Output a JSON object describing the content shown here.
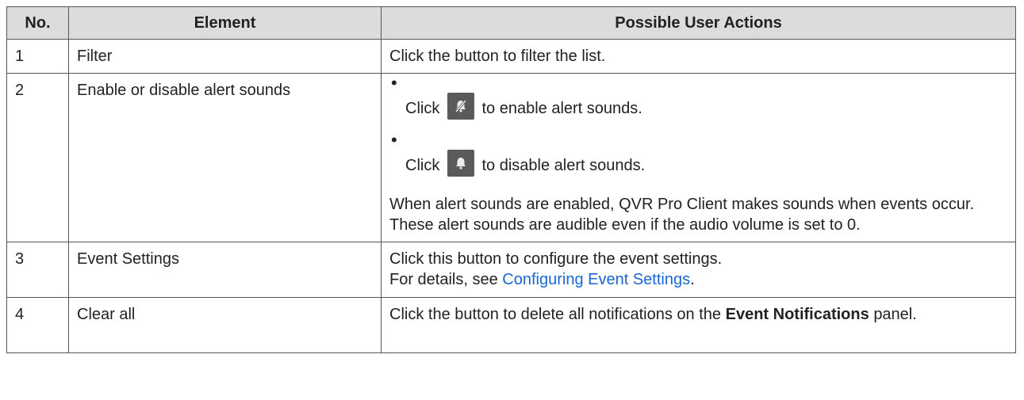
{
  "table": {
    "headers": [
      "No.",
      "Element",
      "Possible User Actions"
    ],
    "rows": [
      {
        "no": "1",
        "element": "Filter",
        "action": "Click the button to filter the list."
      },
      {
        "no": "2",
        "element": "Enable or disable alert sounds",
        "bullet1_prefix": "Click",
        "bullet1_icon": "muted-bell-icon",
        "bullet1_suffix": "to enable alert sounds.",
        "bullet2_prefix": "Click",
        "bullet2_icon": "bell-icon",
        "bullet2_suffix": "to disable alert sounds.",
        "note": "When alert sounds are enabled, QVR Pro Client makes sounds when events occur. These alert sounds are audible even if the audio volume is set to 0."
      },
      {
        "no": "3",
        "element": "Event Settings",
        "action_line1": "Click this button to configure the event settings.",
        "action_line2_prefix": "For details, see",
        "action_link": "Configuring Event Settings",
        "action_line2_suffix": "."
      },
      {
        "no": "4",
        "element": "Clear all",
        "action_prefix": "Click the button to delete all notifications on the",
        "action_bold": "Event Notifications",
        "action_suffix": "panel."
      }
    ]
  },
  "colors": {
    "header_bg": "#dcdcdc",
    "border": "#555555",
    "link": "#1a66d6",
    "icon_bg": "#5a5a5a"
  }
}
